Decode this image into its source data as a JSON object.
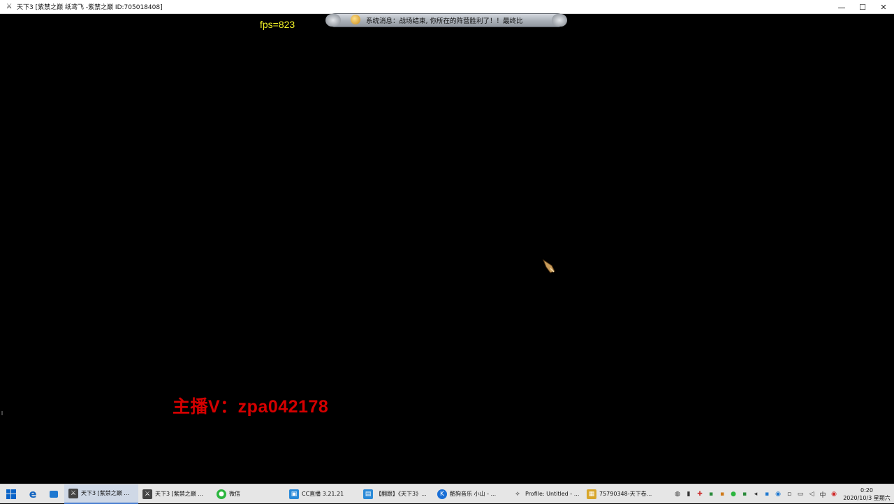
{
  "window": {
    "title": "天下3 [紫禁之巅  纸鸢飞 -紫禁之巅  ID:705018408]",
    "app_icon": "game-icon",
    "controls": {
      "minimize": "—",
      "maximize": "☐",
      "close": "✕"
    }
  },
  "game": {
    "fps_text": "fps=823",
    "system_message": "系统消息：战场结束, 你所在的阵营胜利了！！最终比",
    "watermark": "主播V：zpa042178"
  },
  "taskbar": {
    "items": [
      {
        "label": "天下3 [紫禁之巅 ...",
        "icon": "tianxia3-icon",
        "active": true
      },
      {
        "label": "天下3 [紫禁之巅 ...",
        "icon": "tianxia3-icon",
        "active": false
      },
      {
        "label": "微信",
        "icon": "wechat-icon",
        "active": false
      },
      {
        "label": "CC直播 3.21.21",
        "icon": "cc-live-icon",
        "active": false
      },
      {
        "label": "【翻跟】《天下3》...",
        "icon": "folder-icon",
        "active": false
      },
      {
        "label": "酷狗音乐 小山 - ...",
        "icon": "kugou-icon",
        "active": false
      },
      {
        "label": "Profile: Untitled - ...",
        "icon": "profile-icon",
        "active": false
      },
      {
        "label": "75790348-天下卷...",
        "icon": "game-window-icon",
        "active": false
      }
    ],
    "clock_time": "0:20",
    "clock_date": "2020/10/3 星期六",
    "ime": "中"
  },
  "colors": {
    "fps": "#f2f227",
    "watermark": "#d40000",
    "taskbar_bg": "#e6e6e6"
  }
}
